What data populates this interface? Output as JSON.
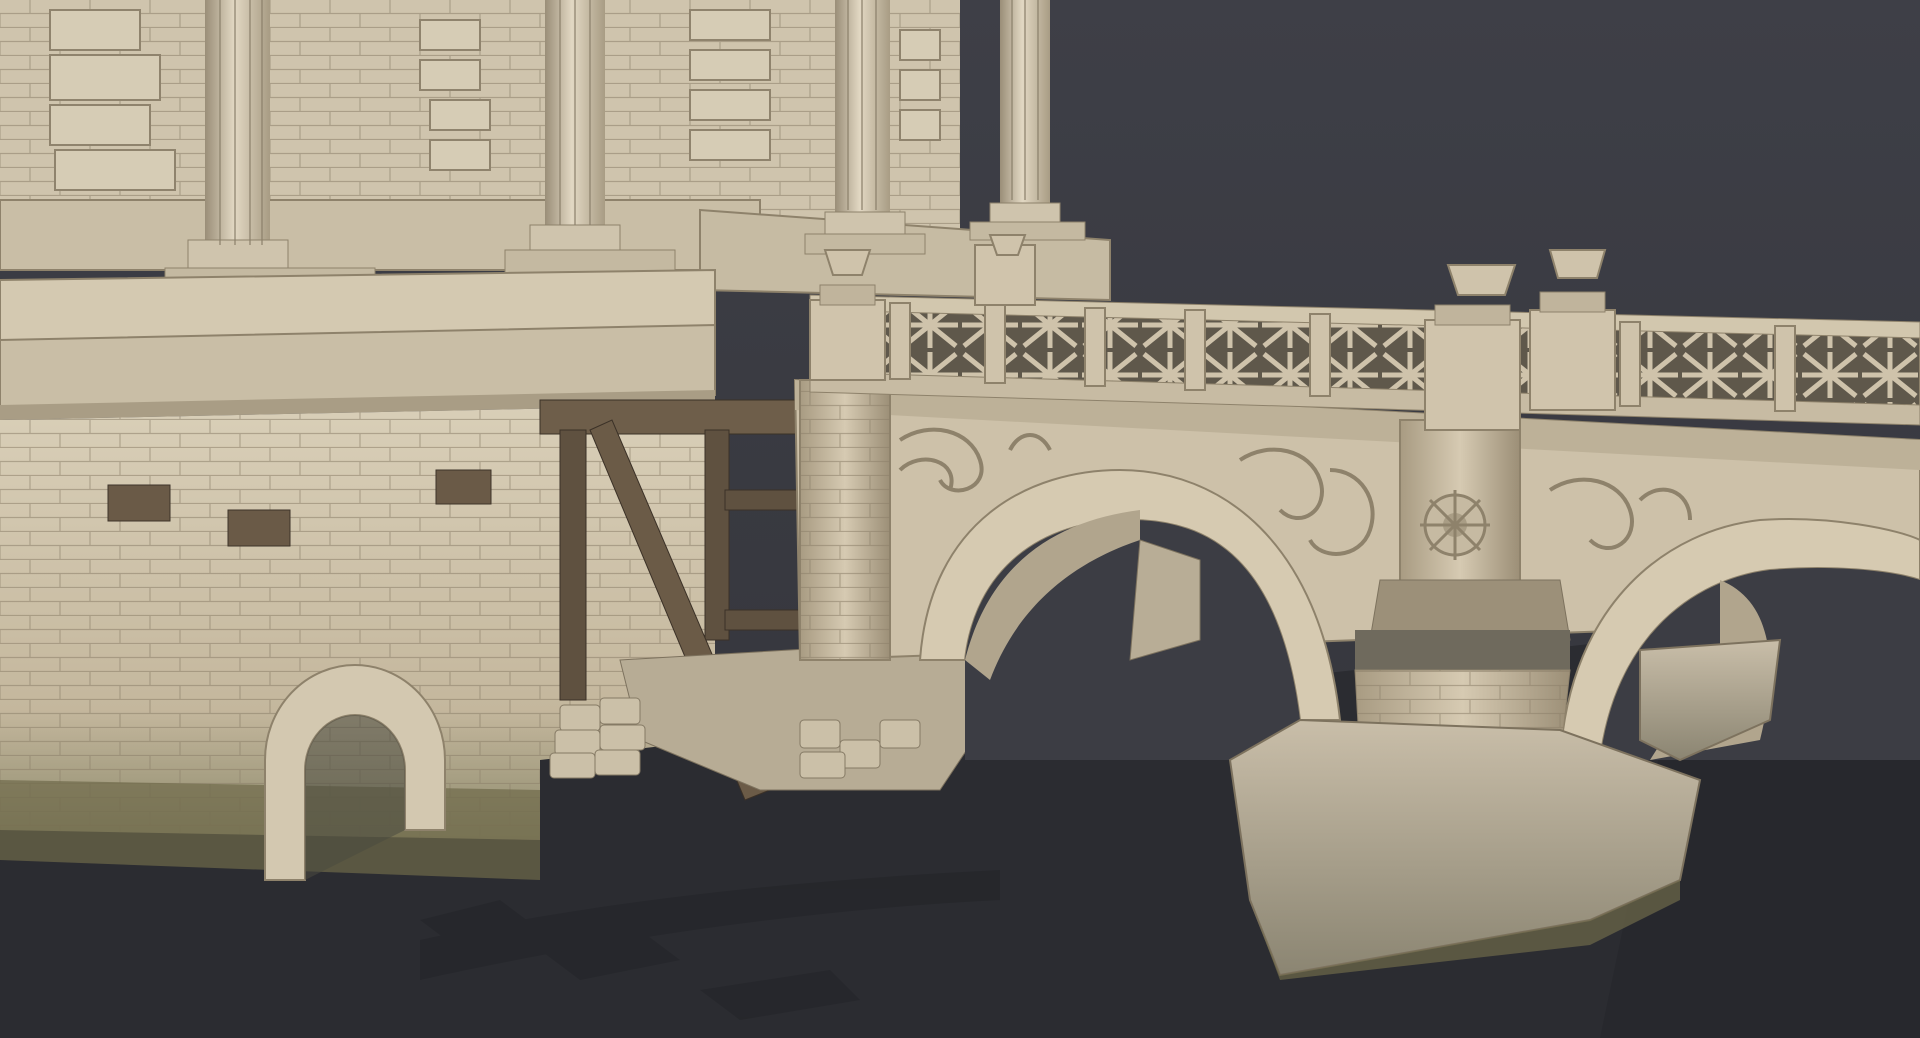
{
  "scene": {
    "subject": "stone-bridge-render",
    "colors": {
      "background": "#3c3d44",
      "ground": "#2a2b30",
      "stone_light": "#d8cdb6",
      "stone_mid": "#bfb29a",
      "stone_dark": "#8f836e",
      "wood": "#6a5a47",
      "moss": "#6f6a4a"
    }
  }
}
